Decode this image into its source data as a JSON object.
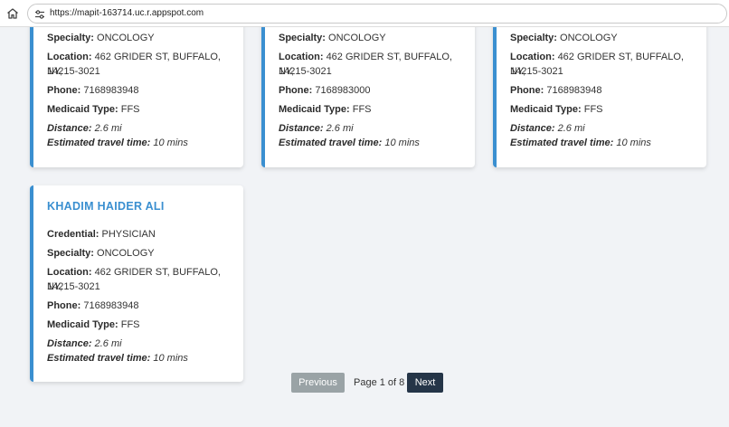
{
  "browser": {
    "url": "https://mapit-163714.uc.r.appspot.com",
    "home_icon": "home-icon",
    "site_info_icon": "tune-icon"
  },
  "labels": {
    "credential": "Credential:",
    "specialty": "Specialty:",
    "location": "Location:",
    "phone": "Phone:",
    "medicaid": "Medicaid Type:",
    "distance": "Distance:",
    "travel": "Estimated travel time:"
  },
  "cards": [
    {
      "specialty": "ONCOLOGY",
      "location_line1": "462 GRIDER ST, BUFFALO, NY,",
      "location_line2": "14215-3021",
      "phone": "7168983948",
      "medicaid": "FFS",
      "distance": "2.6 mi",
      "travel": "10 mins"
    },
    {
      "specialty": "ONCOLOGY",
      "location_line1": "462 GRIDER ST, BUFFALO, NY,",
      "location_line2": "14215-3021",
      "phone": "7168983000",
      "medicaid": "FFS",
      "distance": "2.6 mi",
      "travel": "10 mins"
    },
    {
      "specialty": "ONCOLOGY",
      "location_line1": "462 GRIDER ST, BUFFALO, NY,",
      "location_line2": "14215-3021",
      "phone": "7168983948",
      "medicaid": "FFS",
      "distance": "2.6 mi",
      "travel": "10 mins"
    },
    {
      "name": "KHADIM HAIDER ALI",
      "credential": "PHYSICIAN",
      "specialty": "ONCOLOGY",
      "location_line1": "462 GRIDER ST, BUFFALO, NY,",
      "location_line2": "14215-3021",
      "phone": "7168983948",
      "medicaid": "FFS",
      "distance": "2.6 mi",
      "travel": "10 mins"
    }
  ],
  "pagination": {
    "previous_label": "Previous",
    "page_label": "Page 1 of 8",
    "next_label": "Next"
  },
  "colors": {
    "accent": "#3a8fd0",
    "next_button": "#253548",
    "previous_button": "#9aa3a6",
    "background": "#f1f3f6"
  }
}
